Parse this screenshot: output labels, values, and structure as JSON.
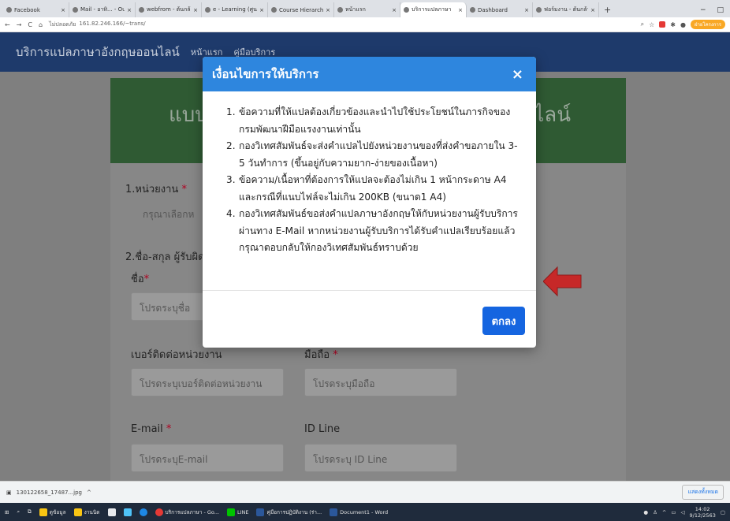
{
  "browser": {
    "tabs": [
      {
        "label": "Facebook",
        "active": false
      },
      {
        "label": "Mail - อาทิ... - Outlook",
        "active": false
      },
      {
        "label": "webfrom - ต้นกล้า E...",
        "active": false
      },
      {
        "label": "e - Learning (ศูนย์พัฒนา...",
        "active": false
      },
      {
        "label": "Course Hierarchic...",
        "active": false
      },
      {
        "label": "หน้าแรก",
        "active": false
      },
      {
        "label": "บริการแปลภาษา",
        "active": true
      },
      {
        "label": "Dashboard",
        "active": false
      },
      {
        "label": "ฟอร์มงาน - ต้นกล้า E...",
        "active": false
      }
    ],
    "new_tab": "+",
    "window_controls": [
      "−",
      "□"
    ],
    "nav": [
      "←",
      "→",
      "C",
      "⌂"
    ],
    "address": {
      "security": "ไม่ปลอดภัย",
      "url": "161.82.246.166/~trans/"
    },
    "profile": "ฝ่ายโครงการ"
  },
  "site": {
    "brand": "บริการแปลภาษาอังกฤษออนไลน์",
    "nav_links": [
      "หน้าแรก",
      "คู่มือบริการ"
    ]
  },
  "form": {
    "header_text": "แบบ",
    "header_tail": "ไลน์",
    "section1_label": "1.หน่วยงาน",
    "agency_placeholder": "กรุณาเลือกห",
    "section2_label": "2.ชื่อ-สกุล ผู้รับผิด",
    "name_label": "ชื่อ",
    "name_placeholder": "โปรดระบุชื่อ",
    "office_phone_label": "เบอร์ติดต่อหน่วยงาน",
    "office_phone_placeholder": "โปรดระบุเบอร์ติดต่อหน่วยงาน",
    "mobile_label": "มือถือ",
    "mobile_placeholder": "โปรดระบุมือถือ",
    "email_label": "E-mail",
    "email_placeholder": "โปรดระบุE-mail",
    "line_label": "ID Line",
    "line_placeholder": "โปรดระบุ ID Line",
    "required_mark": "*"
  },
  "modal": {
    "title": "เงื่อนไขการให้บริการ",
    "close": "×",
    "conditions": [
      {
        "num": "1.",
        "text": "ข้อความที่ให้แปลต้องเกี่ยวข้องและนำไปใช้ประโยชน์ในภารกิจของกรมพัฒนาฝีมือแรงงานเท่านั้น"
      },
      {
        "num": "2.",
        "text": "กองวิเทศสัมพันธ์จะส่งคำแปลไปยังหน่วยงานของที่ส่งคำขอภายใน 3-5 วันทำการ (ขึ้นอยู่กับความยาก-ง่ายของเนื้อหา)"
      },
      {
        "num": "3.",
        "text": "ข้อความ/เนื้อหาที่ต้องการให้แปลจะต้องไม่เกิน 1 หน้ากระดาษ A4 และกรณีที่แนบไฟล์จะไม่เกิน 200KB (ขนาด1 A4)"
      },
      {
        "num": "4.",
        "text": "กองวิเทศสัมพันธ์ขอส่งคำแปลภาษาอังกฤษให้กับหน่วยงานผู้รับบริการผ่านทาง E-Mail หากหน่วยงานผู้รับบริการได้รับคำแปลเรียบร้อยแล้ว กรุณาตอบกลับให้กองวิเทศสัมพันธ์ทราบด้วย"
      }
    ],
    "ok_label": "ตกลง"
  },
  "downloads": {
    "file": "130122658_17487...jpg",
    "chevron": "^",
    "show_all": "แสดงทั้งหมด"
  },
  "taskbar": {
    "apps": [
      "ดูข้อมูล",
      "งานนิด",
      "บริการแปลภาษา - Go...",
      "LINE",
      "คู่มือการปฏิบัติงาน (ร่า...",
      "Document1 - Word"
    ],
    "time": "14:02",
    "date": "9/12/2563"
  },
  "colors": {
    "navbar": "#1e3a6b",
    "modal_header": "#2e86de",
    "ok_button": "#1565e0",
    "card_header": "#2f5a33",
    "arrow": "#c62828"
  }
}
